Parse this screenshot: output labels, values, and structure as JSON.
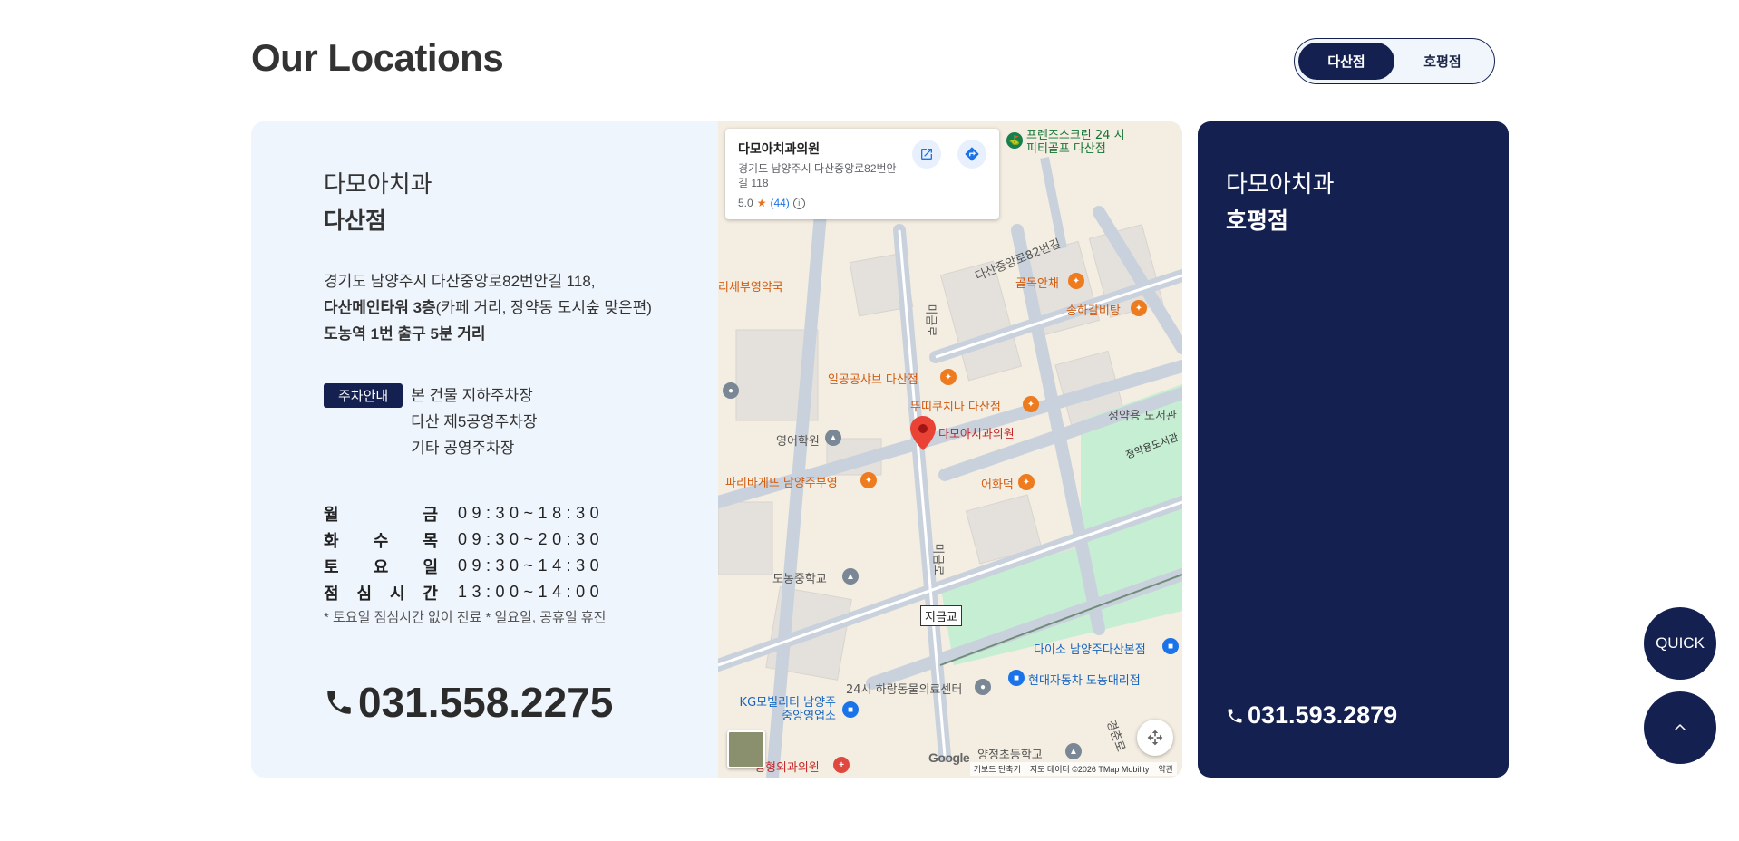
{
  "page": {
    "title": "Our Locations"
  },
  "toggle": {
    "options": [
      "다산점",
      "호평점"
    ],
    "active": "다산점"
  },
  "dasan": {
    "clinic_name": "다모아치과",
    "branch_name": "다산점",
    "address_line1": "경기도 남양주시 다산중앙로82번안길 118,",
    "address_line2_bold": "다산메인타워 3층",
    "address_line2_rest": "(카페 거리, 장약동 도시숲 맞은편)",
    "address_line3_bold": "도농역 1번 출구 5분 거리",
    "parking_badge": "주차안내",
    "parking": [
      "본 건물 지하주차장",
      "다산 제5공영주차장",
      "기타 공영주차장"
    ],
    "hours": [
      {
        "chars": [
          "월",
          "금"
        ],
        "time": "09:30~18:30"
      },
      {
        "chars": [
          "화",
          "수",
          "목"
        ],
        "time": "09:30~20:30"
      },
      {
        "chars": [
          "토",
          "요",
          "일"
        ],
        "time": "09:30~14:30"
      },
      {
        "chars": [
          "점",
          "심",
          "시",
          "간"
        ],
        "time": "13:00~14:00"
      }
    ],
    "hours_note": "* 토요일 점심시간 없이 진료   * 일요일, 공휴일 휴진",
    "phone": "031.558.2275"
  },
  "hopyeong": {
    "clinic_name": "다모아치과",
    "branch_name": "호평점",
    "phone": "031.593.2879"
  },
  "map": {
    "info_title": "다모아치과의원",
    "info_address": "경기도 남양주시 다산중앙로82번안길 118",
    "rating": "5.0",
    "reviews": "(44)",
    "labels": {
      "pharmacy": "리세부영약국",
      "golf": "프렌즈스크린 24 시피티골프 다산점",
      "road1": "다산중앙로82번길",
      "road2": "미금로",
      "road3": "미금로",
      "rest1": "골목안채",
      "rest2": "송하갈비탕",
      "rest3": "일공공샤브 다산점",
      "rest4": "뚜띠쿠치나 다산점",
      "clinic": "다모아치과의원",
      "academy": "영어학원",
      "library1": "정약용 도서관",
      "library2": "정약용도서관",
      "bakery": "파리바게뜨 남양주부영",
      "fish": "어화덕",
      "school": "도농중학교",
      "station": "지금교",
      "daiso": "다이소 남양주다산본점",
      "hyundai": "현대자동차 도농대리점",
      "medical": "24시 하랑동물의료센터",
      "kg": "KG모빌리티 남양주중앙영업소",
      "elem": "양정초등학교",
      "ortho": "정형외과의원",
      "road4": "경춘로",
      "google": "Google",
      "attr1": "키보드 단축키",
      "attr2": "지도 데이터 ©2026 TMap Mobility",
      "attr3": "약관"
    }
  },
  "floating": {
    "quick": "QUICK"
  },
  "colors": {
    "navy": "#142150",
    "card_bg": "#eff5fd"
  }
}
